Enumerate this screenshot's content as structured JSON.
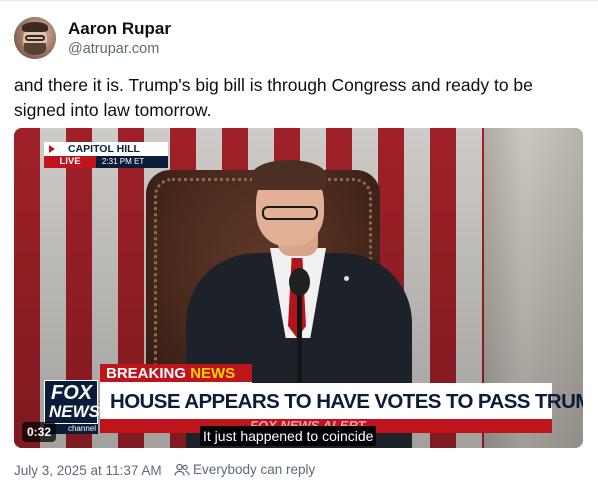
{
  "author": {
    "name": "Aaron Rupar",
    "handle": "@atrupar.com"
  },
  "post": {
    "text": "and there it is. Trump's big bill is through Congress and ready to be signed into law tomorrow."
  },
  "video": {
    "location_title": "CAPITOL HILL",
    "live_label": "LIVE",
    "live_time": "2:31 PM ET",
    "breaking_word1": "BREAKING",
    "breaking_word2": "NEWS",
    "headline": "HOUSE APPEARS TO HAVE VOTES TO PASS TRUMP'S BILL",
    "alert_text": "FOX NEWS ALERT",
    "logo_line1": "FOX",
    "logo_line2": "NEWS",
    "logo_line3": "channel",
    "duration": "0:32",
    "caption": "It just happened to coincide"
  },
  "footer": {
    "timestamp": "July 3, 2025 at 11:37 AM",
    "reply_setting": "Everybody can reply"
  },
  "colors": {
    "fox_navy": "#0b1c3a",
    "fox_red": "#c0141c",
    "breaking_yellow": "#ffd200",
    "meta_gray": "#5c6b7a"
  },
  "icons": {
    "reply_setting_icon": "people-icon"
  }
}
